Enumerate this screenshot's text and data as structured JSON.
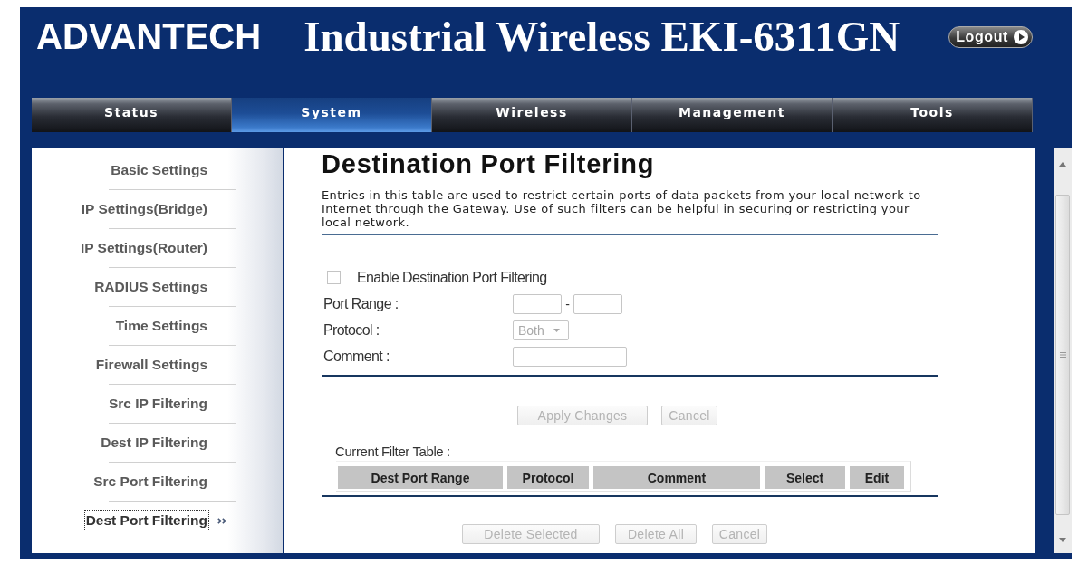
{
  "header": {
    "logo": "ADVANTECH",
    "title": "Industrial Wireless EKI-6311GN",
    "logout": "Logout"
  },
  "nav": [
    {
      "label": "Status",
      "selected": false
    },
    {
      "label": "System",
      "selected": true
    },
    {
      "label": "Wireless",
      "selected": false
    },
    {
      "label": "Management",
      "selected": false
    },
    {
      "label": "Tools",
      "selected": false
    }
  ],
  "sidebar": {
    "items": [
      {
        "label": "Basic Settings",
        "selected": false
      },
      {
        "label": "IP Settings(Bridge)",
        "selected": false
      },
      {
        "label": "IP Settings(Router)",
        "selected": false
      },
      {
        "label": "RADIUS Settings",
        "selected": false
      },
      {
        "label": "Time Settings",
        "selected": false
      },
      {
        "label": "Firewall Settings",
        "selected": false
      },
      {
        "label": "Src IP Filtering",
        "selected": false
      },
      {
        "label": "Dest IP Filtering",
        "selected": false
      },
      {
        "label": "Src Port Filtering",
        "selected": false
      },
      {
        "label": "Dest Port Filtering",
        "selected": true
      }
    ]
  },
  "page": {
    "title": "Destination Port Filtering",
    "description": "Entries in this table are used to restrict certain ports of data packets from your local network to Internet through the Gateway. Use of such filters can be helpful in securing or restricting your local network."
  },
  "form": {
    "enable": {
      "label": "Enable Destination Port Filtering",
      "checked": false
    },
    "port_range": {
      "label": "Port Range :",
      "separator": "-"
    },
    "protocol": {
      "label": "Protocol :",
      "value": "Both",
      "disabled": true
    },
    "comment": {
      "label": "Comment :"
    }
  },
  "form_buttons": [
    {
      "label": "Apply Changes",
      "disabled": true
    },
    {
      "label": "Cancel",
      "disabled": true
    }
  ],
  "filter_table": {
    "caption": "Current Filter Table :",
    "columns": [
      "Dest Port Range",
      "Protocol",
      "Comment",
      "Select",
      "Edit"
    ]
  },
  "table_buttons": [
    {
      "label": "Delete Selected",
      "disabled": true
    },
    {
      "label": "Delete All",
      "disabled": true
    },
    {
      "label": "Cancel",
      "disabled": true
    }
  ]
}
